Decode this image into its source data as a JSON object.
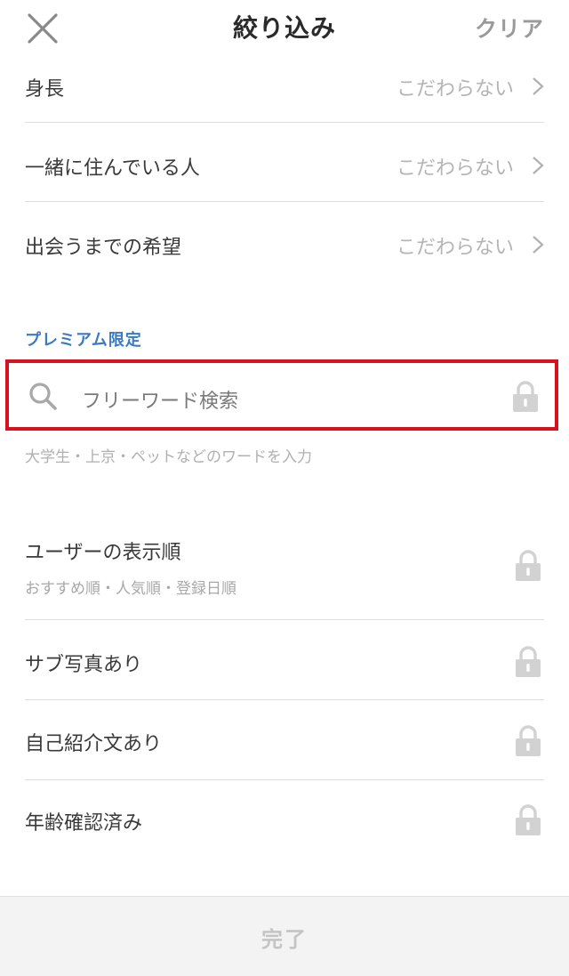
{
  "header": {
    "title": "絞り込み",
    "clear_label": "クリア"
  },
  "filters": [
    {
      "label": "身長",
      "value": "こだわらない"
    },
    {
      "label": "一緒に住んでいる人",
      "value": "こだわらない"
    },
    {
      "label": "出会うまでの希望",
      "value": "こだわらない"
    }
  ],
  "premium": {
    "section_label": "プレミアム限定",
    "search": {
      "text": "フリーワード検索",
      "hint": "大学生・上京・ペットなどのワードを入力"
    },
    "items": [
      {
        "label": "ユーザーの表示順",
        "sub": "おすすめ順・人気順・登録日順"
      },
      {
        "label": "サブ写真あり"
      },
      {
        "label": "自己紹介文あり"
      },
      {
        "label": "年齢確認済み"
      }
    ]
  },
  "footer": {
    "done_label": "完了"
  },
  "colors": {
    "accent": "#3b7ac2",
    "highlight_border": "#d7121e",
    "muted": "#b4b4b4"
  }
}
